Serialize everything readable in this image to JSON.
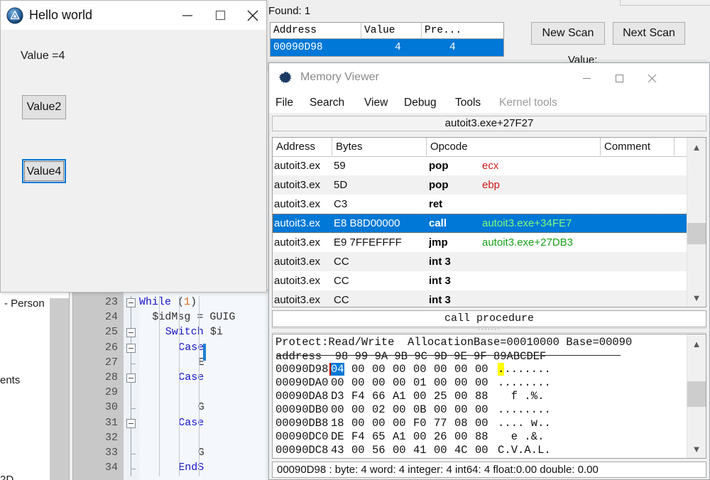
{
  "hello_window": {
    "title": "Hello world",
    "icon": "autoit-logo-icon",
    "minimize": "—",
    "maximize": "□",
    "close": "✕",
    "value_label": "Value =4",
    "buttons": [
      {
        "label": "Value2",
        "focused": false
      },
      {
        "label": "Value4",
        "focused": true
      }
    ]
  },
  "cheat_engine": {
    "found_label": "Found: 1",
    "scan_table": {
      "headers": [
        "Address",
        "Value",
        "Pre..."
      ],
      "rows": [
        {
          "address": "00090D98",
          "value": "4",
          "previous": "4",
          "selected": true
        }
      ]
    },
    "new_scan_button": "New Scan",
    "next_scan_button": "Next Scan",
    "value_caption": "Value:"
  },
  "memory_viewer": {
    "title": "Memory Viewer",
    "icon": "cheat-engine-logo-icon",
    "minimize": "—",
    "maximize": "□",
    "close": "✕",
    "menu": [
      {
        "label": "File",
        "enabled": true
      },
      {
        "label": "Search",
        "enabled": true
      },
      {
        "label": "View",
        "enabled": true
      },
      {
        "label": "Debug",
        "enabled": true
      },
      {
        "label": "Tools",
        "enabled": true
      },
      {
        "label": "Kernel tools",
        "enabled": false
      }
    ],
    "address_bar": "autoit3.exe+27F27",
    "disassembler": {
      "headers": [
        "Address",
        "Bytes",
        "Opcode",
        "Comment"
      ],
      "rows": [
        {
          "address": "autoit3.ex",
          "bytes": "59",
          "mnemonic": "pop",
          "operand": "ecx",
          "operand_color": "red",
          "comment": "",
          "selected": false
        },
        {
          "address": "autoit3.ex",
          "bytes": "5D",
          "mnemonic": "pop",
          "operand": "ebp",
          "operand_color": "red",
          "comment": "",
          "selected": false
        },
        {
          "address": "autoit3.ex",
          "bytes": "C3",
          "mnemonic": "ret",
          "operand": "",
          "operand_color": "none",
          "comment": "",
          "selected": false
        },
        {
          "address": "autoit3.ex",
          "bytes": "E8 B8D00000",
          "mnemonic": "call",
          "operand": "autoit3.exe+34FE7",
          "operand_color": "green",
          "comment": "",
          "selected": true
        },
        {
          "address": "autoit3.ex",
          "bytes": "E9 7FFEFFFF",
          "mnemonic": "jmp",
          "operand": "autoit3.exe+27DB3",
          "operand_color": "green",
          "comment": "",
          "selected": false
        },
        {
          "address": "autoit3.ex",
          "bytes": "CC",
          "mnemonic": "int 3",
          "operand": "",
          "operand_color": "none",
          "comment": "",
          "selected": false
        },
        {
          "address": "autoit3.ex",
          "bytes": "CC",
          "mnemonic": "int 3",
          "operand": "",
          "operand_color": "none",
          "comment": "",
          "selected": false
        },
        {
          "address": "autoit3.ex",
          "bytes": "CC",
          "mnemonic": "int 3",
          "operand": "",
          "operand_color": "none",
          "comment": "",
          "selected": false
        }
      ]
    },
    "call_procedure_bar": "call procedure",
    "hex_view": {
      "protect_line": "Protect:Read/Write  AllocationBase=00010000 Base=00090",
      "column_header": "address  98 99 9A 9B 9C 9D 9E 9F 89ABCDEF",
      "rows": [
        {
          "address": "00090D98",
          "bytes": [
            "04",
            "00",
            "00",
            "00",
            "00",
            "00",
            "00",
            "00"
          ],
          "ascii": "........",
          "selected_byte_index": 0,
          "selected_ascii_index": 0
        },
        {
          "address": "00090DA0",
          "bytes": [
            "00",
            "00",
            "00",
            "00",
            "01",
            "00",
            "00",
            "00"
          ],
          "ascii": "........",
          "selected_byte_index": -1,
          "selected_ascii_index": -1
        },
        {
          "address": "00090DA8",
          "bytes": [
            "D3",
            "F4",
            "66",
            "A1",
            "00",
            "25",
            "00",
            "88"
          ],
          "ascii": "  f .%.",
          "selected_byte_index": -1,
          "selected_ascii_index": -1
        },
        {
          "address": "00090DB0",
          "bytes": [
            "00",
            "00",
            "02",
            "00",
            "0B",
            "00",
            "00",
            "00"
          ],
          "ascii": "........",
          "selected_byte_index": -1,
          "selected_ascii_index": -1
        },
        {
          "address": "00090DB8",
          "bytes": [
            "18",
            "00",
            "00",
            "00",
            "F0",
            "77",
            "08",
            "00"
          ],
          "ascii": ".... w..",
          "selected_byte_index": -1,
          "selected_ascii_index": -1
        },
        {
          "address": "00090DC0",
          "bytes": [
            "DE",
            "F4",
            "65",
            "A1",
            "00",
            "26",
            "00",
            "88"
          ],
          "ascii": "  e .&.",
          "selected_byte_index": -1,
          "selected_ascii_index": -1
        },
        {
          "address": "00090DC8",
          "bytes": [
            "43",
            "00",
            "56",
            "00",
            "41",
            "00",
            "4C",
            "00"
          ],
          "ascii": "C.V.A.L.",
          "selected_byte_index": -1,
          "selected_ascii_index": -1
        }
      ]
    },
    "status_bar": "00090D98 : byte: 4 word: 4 integer: 4 int64: 4 float:0.00 double: 0.00"
  },
  "code_editor": {
    "lines": [
      {
        "number": "23",
        "indent": 0,
        "tokens": [
          {
            "t": "While",
            "c": "kw"
          },
          {
            "t": " ",
            "c": "op"
          },
          {
            "t": "(",
            "c": "op"
          },
          {
            "t": "1",
            "c": "num"
          },
          {
            "t": ")",
            "c": "op"
          }
        ],
        "fold": "box"
      },
      {
        "number": "24",
        "indent": 2,
        "tokens": [
          {
            "t": "$idMsg",
            "c": "var"
          },
          {
            "t": " = ",
            "c": "op"
          },
          {
            "t": "GUIG",
            "c": "var"
          }
        ],
        "fold": "line"
      },
      {
        "number": "25",
        "indent": 4,
        "tokens": [
          {
            "t": "Switch",
            "c": "kw"
          },
          {
            "t": " $i",
            "c": "var"
          }
        ],
        "fold": "box"
      },
      {
        "number": "26",
        "indent": 6,
        "tokens": [
          {
            "t": "Case",
            "c": "kw"
          }
        ],
        "fold": "box"
      },
      {
        "number": "27",
        "indent": 9,
        "tokens": [
          {
            "t": "E",
            "c": "var"
          }
        ],
        "fold": "tick"
      },
      {
        "number": "28",
        "indent": 6,
        "tokens": [
          {
            "t": "Case",
            "c": "kw"
          }
        ],
        "fold": "box"
      },
      {
        "number": "29",
        "indent": 0,
        "tokens": [],
        "fold": "line"
      },
      {
        "number": "30",
        "indent": 9,
        "tokens": [
          {
            "t": "G",
            "c": "var"
          }
        ],
        "fold": "tick"
      },
      {
        "number": "31",
        "indent": 6,
        "tokens": [
          {
            "t": "Case",
            "c": "kw"
          }
        ],
        "fold": "box"
      },
      {
        "number": "32",
        "indent": 0,
        "tokens": [],
        "fold": "line"
      },
      {
        "number": "33",
        "indent": 9,
        "tokens": [
          {
            "t": "G",
            "c": "var"
          }
        ],
        "fold": "tick"
      },
      {
        "number": "34",
        "indent": 6,
        "tokens": [
          {
            "t": "EndS",
            "c": "kw"
          }
        ],
        "fold": "tick"
      }
    ]
  },
  "background_window": {
    "fragments": [
      "- Person",
      "ents",
      "2D"
    ]
  }
}
